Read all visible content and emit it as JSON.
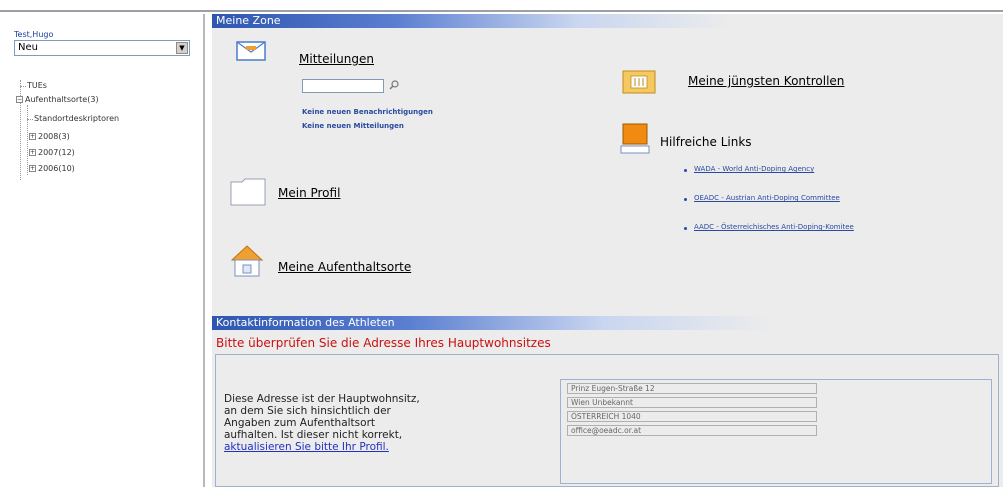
{
  "sidebar": {
    "user": "Test,Hugo",
    "status_selected": "Neu",
    "tree": {
      "tues": "TUEs",
      "whereabouts": "Aufenthaltsorte(3)",
      "location_descriptors": "Standortdeskriptoren",
      "years": [
        "2008(3)",
        "2007(12)",
        "2006(10)"
      ]
    }
  },
  "zone": {
    "header": "Meine Zone",
    "messages": {
      "title": "Mitteilungen",
      "no_notifications": "Keine neuen Benachrichtigungen",
      "no_messages": "Keine neuen Mitteilungen"
    },
    "profile": "Mein Profil",
    "whereabouts": "Meine Aufenthaltsorte",
    "controls": "Meine jüngsten Kontrollen",
    "helpful_links": {
      "title": "Hilfreiche Links",
      "items": [
        "WADA - World Anti-Doping Agency",
        "OEADC - Austrian Anti-Doping Committee",
        "AADC - Österreichisches Anti-Doping-Komitee"
      ]
    }
  },
  "contact": {
    "header": "Kontaktinformation des Athleten",
    "check_address": "Bitte überprüfen Sie die Adresse Ihres Hauptwohnsitzes",
    "text_before": "Diese Adresse ist der Hauptwohnsitz, an dem Sie sich hinsichtlich der Angaben zum Aufenthaltsort aufhalten. Ist dieser nicht korrekt, ",
    "update_link": "aktualisieren Sie bitte Ihr Profil.",
    "address": [
      "Prinz Eugen-Straße 12",
      "Wien Unbekannt",
      "ÖSTERREICH 1040",
      "office@oeadc.or.at"
    ]
  },
  "colors": {
    "header_blue": "#2e56b0",
    "warning_red": "#cc1010",
    "panel_bg": "#ececec",
    "link_blue": "#2a4aa0"
  }
}
